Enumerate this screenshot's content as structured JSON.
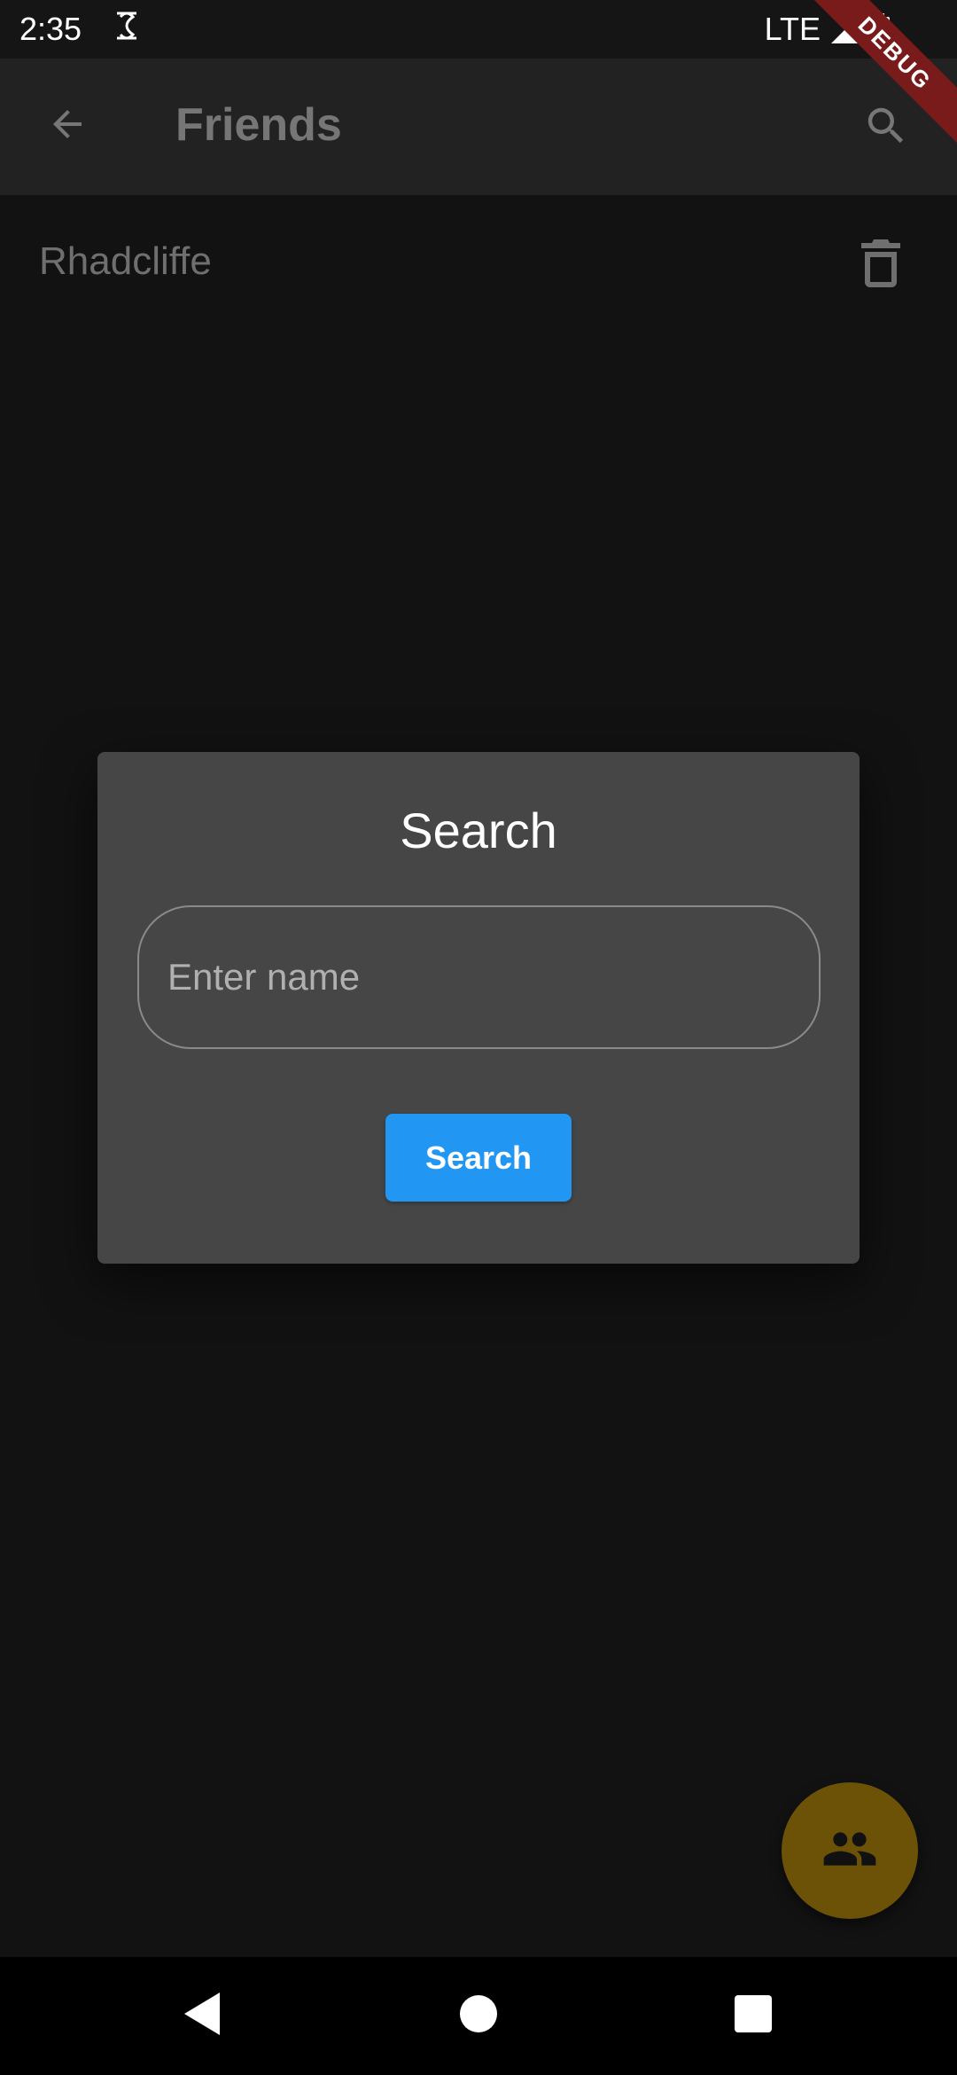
{
  "status_bar": {
    "time": "2:35",
    "network": "LTE",
    "icons": [
      "sim-icon",
      "signal-icon",
      "battery-icon"
    ]
  },
  "debug_banner": {
    "label": "DEBUG"
  },
  "app_bar": {
    "title": "Friends",
    "back_icon": "arrow-left-icon",
    "search_icon": "search-icon"
  },
  "friends": [
    {
      "name": "Rhadcliffe",
      "delete_icon": "trash-icon"
    }
  ],
  "dialog": {
    "title": "Search",
    "input": {
      "value": "",
      "placeholder": "Enter name"
    },
    "button_label": "Search",
    "button_color": "#2196f3"
  },
  "fab": {
    "icon": "people-icon",
    "color": "#6b5206"
  },
  "colors": {
    "background": "#121212",
    "app_bar": "#222222",
    "dialog": "#464646"
  }
}
